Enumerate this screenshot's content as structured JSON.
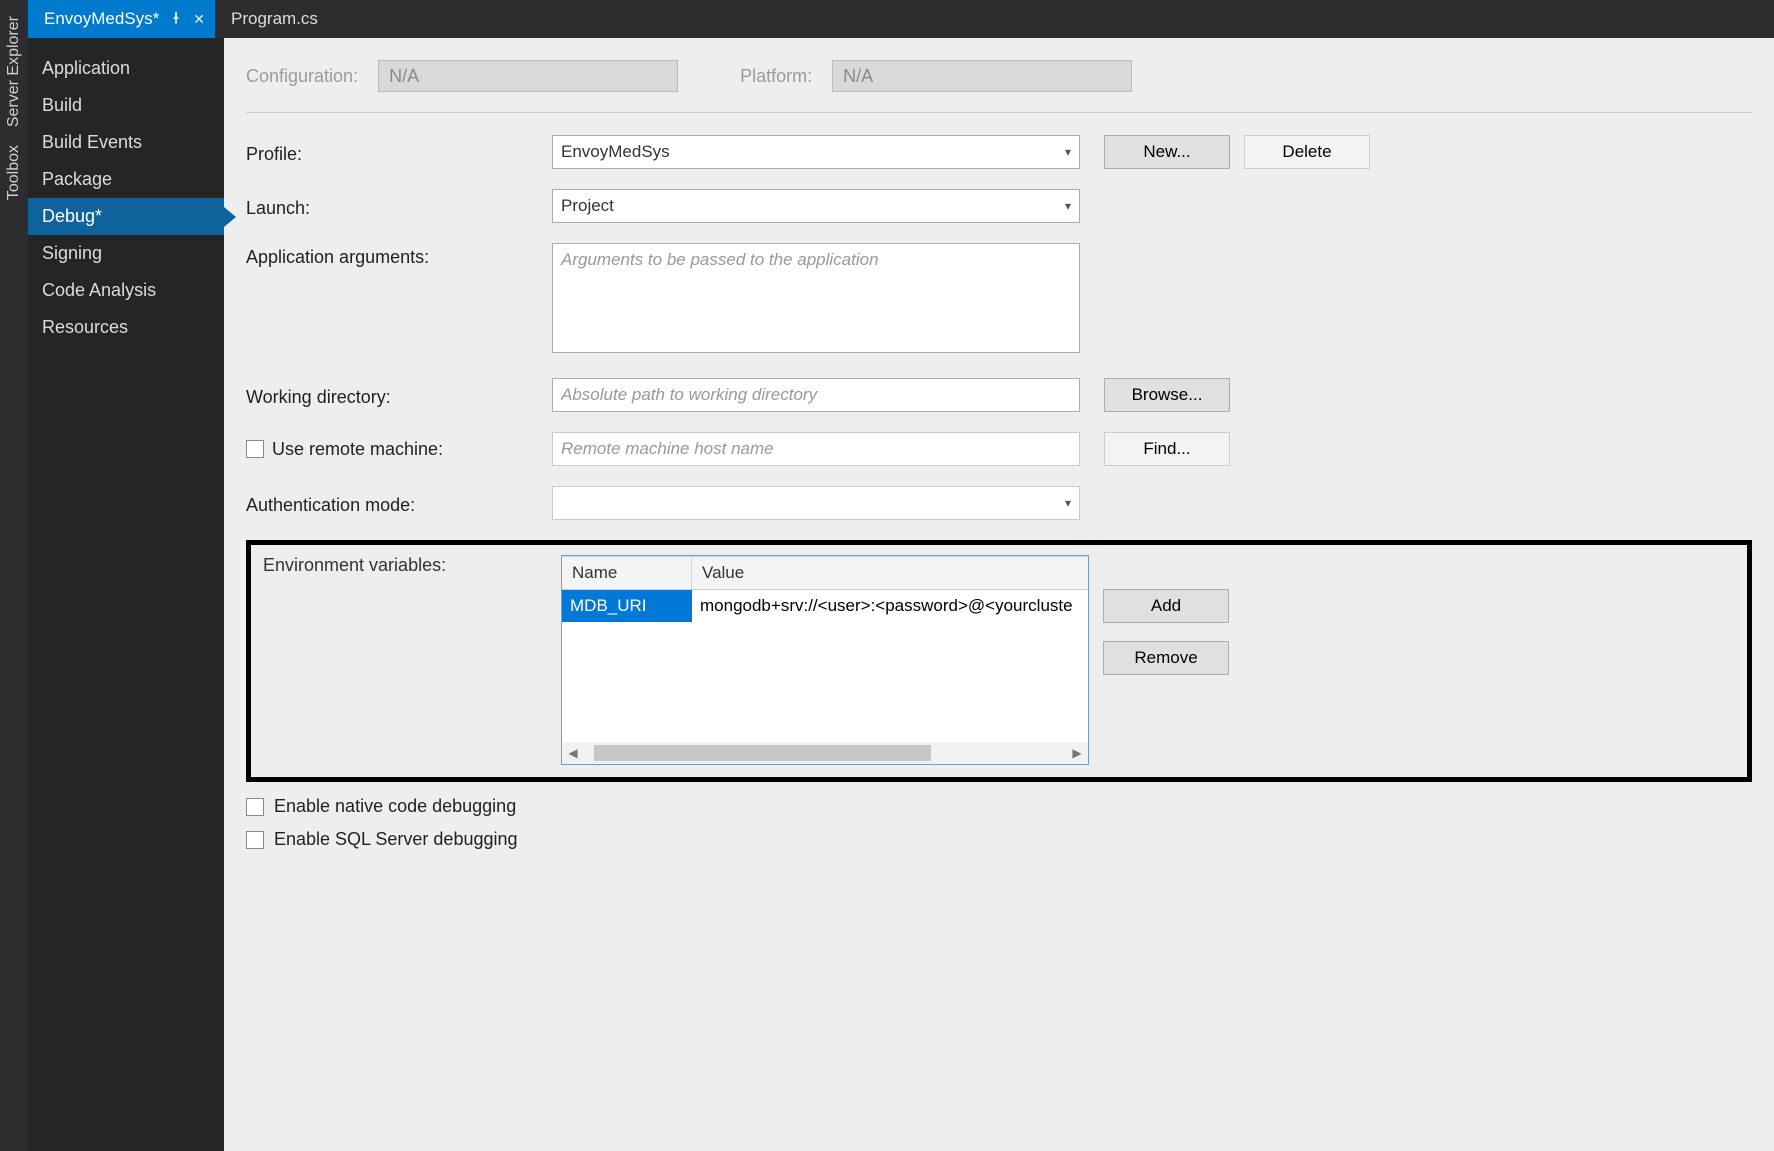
{
  "tool_strip": {
    "items": [
      "Server Explorer",
      "Toolbox"
    ]
  },
  "tabs": {
    "active": "EnvoyMedSys*",
    "inactive": "Program.cs"
  },
  "sidebar": {
    "items": [
      "Application",
      "Build",
      "Build Events",
      "Package",
      "Debug*",
      "Signing",
      "Code Analysis",
      "Resources"
    ],
    "selected_index": 4
  },
  "topbar": {
    "config_label": "Configuration:",
    "config_value": "N/A",
    "platform_label": "Platform:",
    "platform_value": "N/A"
  },
  "form": {
    "profile_label": "Profile:",
    "profile_value": "EnvoyMedSys",
    "new_btn": "New...",
    "delete_btn": "Delete",
    "launch_label": "Launch:",
    "launch_value": "Project",
    "appargs_label": "Application arguments:",
    "appargs_placeholder": "Arguments to be passed to the application",
    "workdir_label": "Working directory:",
    "workdir_placeholder": "Absolute path to working directory",
    "browse_btn": "Browse...",
    "remote_check_label": "Use remote machine:",
    "remote_placeholder": "Remote machine host name",
    "find_btn": "Find...",
    "auth_label": "Authentication mode:"
  },
  "env": {
    "label": "Environment variables:",
    "header_name": "Name",
    "header_value": "Value",
    "row_name": "MDB_URI",
    "row_value": "mongodb+srv://<user>:<password>@<yourcluste",
    "add_btn": "Add",
    "remove_btn": "Remove"
  },
  "final": {
    "native": "Enable native code debugging",
    "sql": "Enable SQL Server debugging"
  }
}
